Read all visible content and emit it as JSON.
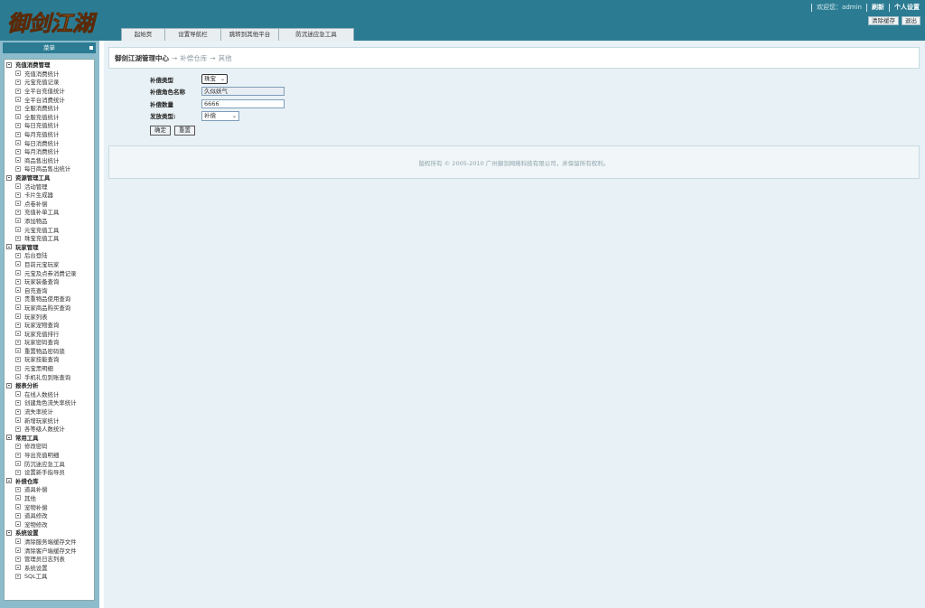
{
  "header": {
    "welcome": "欢迎您：admin",
    "links": [
      "刷新",
      "个人设置"
    ],
    "buttons": [
      "清除缓存",
      "退出"
    ]
  },
  "tabs": [
    "起始页",
    "设置导航栏",
    "跳转到其他平台",
    "防沉迷应急工具"
  ],
  "sidebar": {
    "title": "菜单",
    "categories": [
      {
        "name": "充值消费管理",
        "items": [
          "充值消费统计",
          "元宝充值记录",
          "全平台充值统计",
          "全平台消费统计",
          "全服消费统计",
          "全服充值统计",
          "每日充值统计",
          "每月充值统计",
          "每日消费统计",
          "每月消费统计",
          "商品售出统计",
          "每日商品售出统计"
        ]
      },
      {
        "name": "资源管理工具",
        "items": [
          "活动管理",
          "卡片生成器",
          "点卷补偿",
          "充值补单工具",
          "添加物品",
          "元宝充值工具",
          "珠宝充值工具"
        ]
      },
      {
        "name": "玩家管理",
        "items": [
          "后台登陆",
          "目前元宝玩家",
          "元宝及点券消费记录",
          "玩家装备查询",
          "自充查询",
          "贵重物品使用查询",
          "玩家商品购买查询",
          "玩家列表",
          "玩家宠物查询",
          "玩家充值排行",
          "玩家密码查询",
          "重置物品密码锁",
          "玩家技能查询",
          "元宝黑明细",
          "手机礼包到账查询"
        ]
      },
      {
        "name": "报表分析",
        "items": [
          "在线人数统计",
          "创建角色流失率统计",
          "流失率统计",
          "新增玩家统计",
          "各等级人数统计"
        ]
      },
      {
        "name": "常用工具",
        "items": [
          "修改密码",
          "导出充值明细",
          "防沉迷应急工具",
          "设置新手指导员"
        ]
      },
      {
        "name": "补偿仓库",
        "items": [
          "道具补偿",
          "其他",
          "宠物补偿",
          "道具修改",
          "宠物修改"
        ]
      },
      {
        "name": "系统设置",
        "items": [
          "清除服务端缓存文件",
          "清除客户端缓存文件",
          "管理员日志列表",
          "系统设置",
          "SQL工具"
        ]
      }
    ]
  },
  "main": {
    "title": "御剑江湖管理中心",
    "breadcrumb": [
      "补偿仓库",
      "其他"
    ],
    "form": {
      "gift_type_label": "补偿类型",
      "gift_type_value": "珠宝",
      "name_label": "补偿角色名称",
      "name_value": "久似妖气",
      "qty_label": "补偿数量",
      "qty_value": "6666",
      "send_type_label": "发放类型:",
      "send_type_value": "补偿",
      "ok": "确定",
      "reset": "重置"
    },
    "footer": "版权所有 © 2005-2010 广州御剑网络科技有限公司，并保留所有权利。"
  },
  "logo": {
    "text": "御剑江湖",
    "colors": [
      "#ffd54a",
      "#c8631a"
    ]
  },
  "colors": {
    "header": "#2b7c93",
    "sidebar": "#8cbccc",
    "main_bg": "#e8f1f5"
  }
}
